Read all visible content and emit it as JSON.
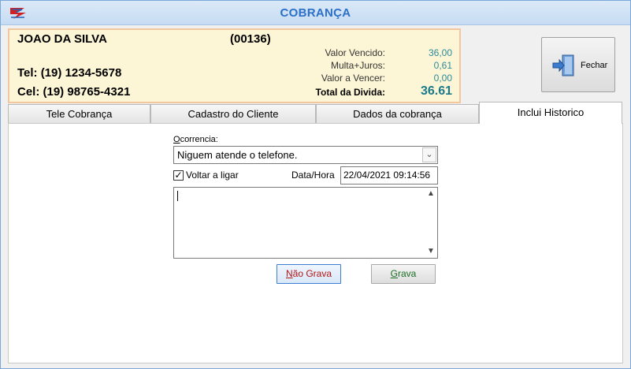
{
  "window": {
    "title": "COBRANÇA",
    "accent_color": "#2b6fc9"
  },
  "client": {
    "name": "JOAO DA SILVA",
    "code": "(00136)",
    "tel": "Tel: (19) 1234-5678",
    "cel": "Cel: (19) 98765-4321"
  },
  "amounts": {
    "vencido_label": "Valor Vencido:",
    "vencido_value": "36,00",
    "multa_label": "Multa+Juros:",
    "multa_value": "0,61",
    "a_vencer_label": "Valor a Vencer:",
    "a_vencer_value": "0,00",
    "total_label": "Total da Divida:",
    "total_value": "36.61"
  },
  "toolbar": {
    "fechar_label": "Fechar",
    "fechar_icon": "exit-door-icon"
  },
  "tabs": [
    {
      "label": "Tele Cobrança"
    },
    {
      "label": "Cadastro do Cliente"
    },
    {
      "label": "Dados da cobrança"
    },
    {
      "label": "Inclui Historico",
      "active": true
    }
  ],
  "form": {
    "ocorrencia_label_first": "O",
    "ocorrencia_label_rest": "correncia:",
    "ocorrencia_value": "Niguem atende o telefone.",
    "voltar_label": "Voltar a ligar",
    "voltar_checked": true,
    "datahora_label": "Data/Hora",
    "datahora_value": "22/04/2021 09:14:56",
    "memo_value": ""
  },
  "buttons": {
    "nao_grava_first": "N",
    "nao_grava_rest": "ão Grava",
    "grava_first": "G",
    "grava_rest": "rava"
  }
}
